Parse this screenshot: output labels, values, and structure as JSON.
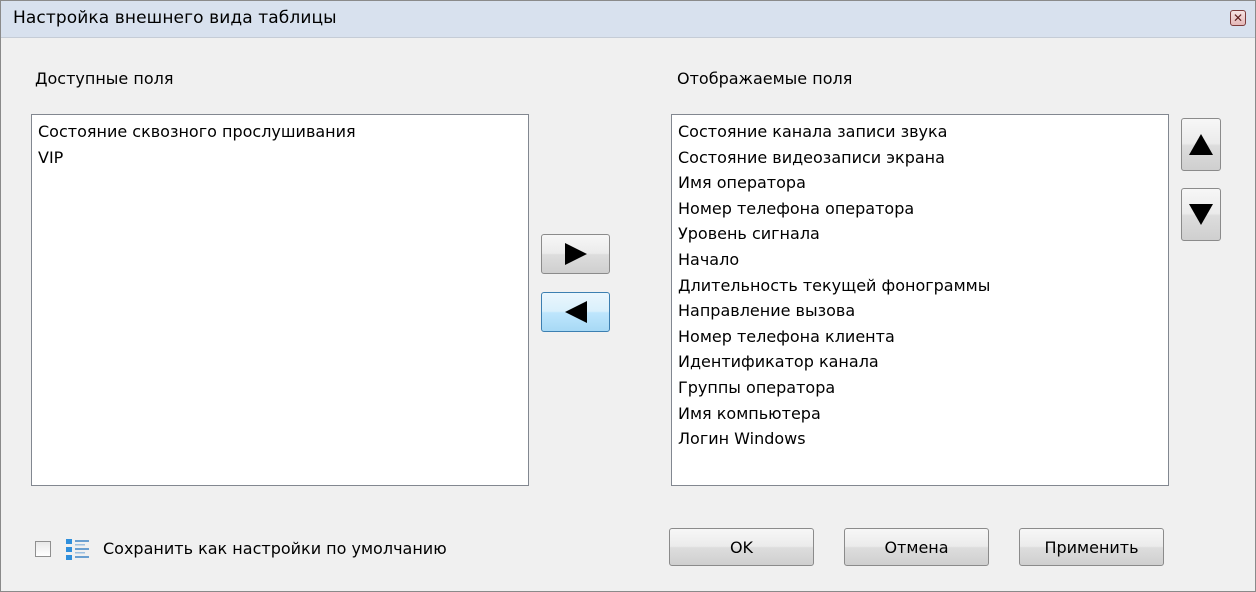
{
  "window": {
    "title": "Настройка внешнего вида таблицы",
    "close_icon": "close-icon"
  },
  "available": {
    "label": "Доступные поля",
    "items": [
      "Состояние сквозного прослушивания",
      "VIP"
    ]
  },
  "displayed": {
    "label": "Отображаемые поля",
    "items": [
      "Состояние канала записи звука",
      "Состояние видеозаписи экрана",
      "Имя оператора",
      "Номер телефона оператора",
      "Уровень сигнала",
      "Начало",
      "Длительность текущей фонограммы",
      "Направление вызова",
      "Номер телефона клиента",
      "Идентификатор канала",
      "Группы оператора",
      "Имя компьютера",
      "Логин Windows"
    ]
  },
  "transfer_buttons": {
    "add_icon": "arrow-right-icon",
    "remove_icon": "arrow-left-icon"
  },
  "order_buttons": {
    "up_icon": "arrow-up-icon",
    "down_icon": "arrow-down-icon"
  },
  "footer": {
    "save_default_checked": false,
    "save_default_label": "Сохранить как настройки по умолчанию",
    "ok_label": "OK",
    "cancel_label": "Отмена",
    "apply_label": "Применить"
  },
  "colors": {
    "titlebar": "#d8e1ee",
    "focus_button": "#bee6fd",
    "icon_blue": "#2f8fdc"
  }
}
